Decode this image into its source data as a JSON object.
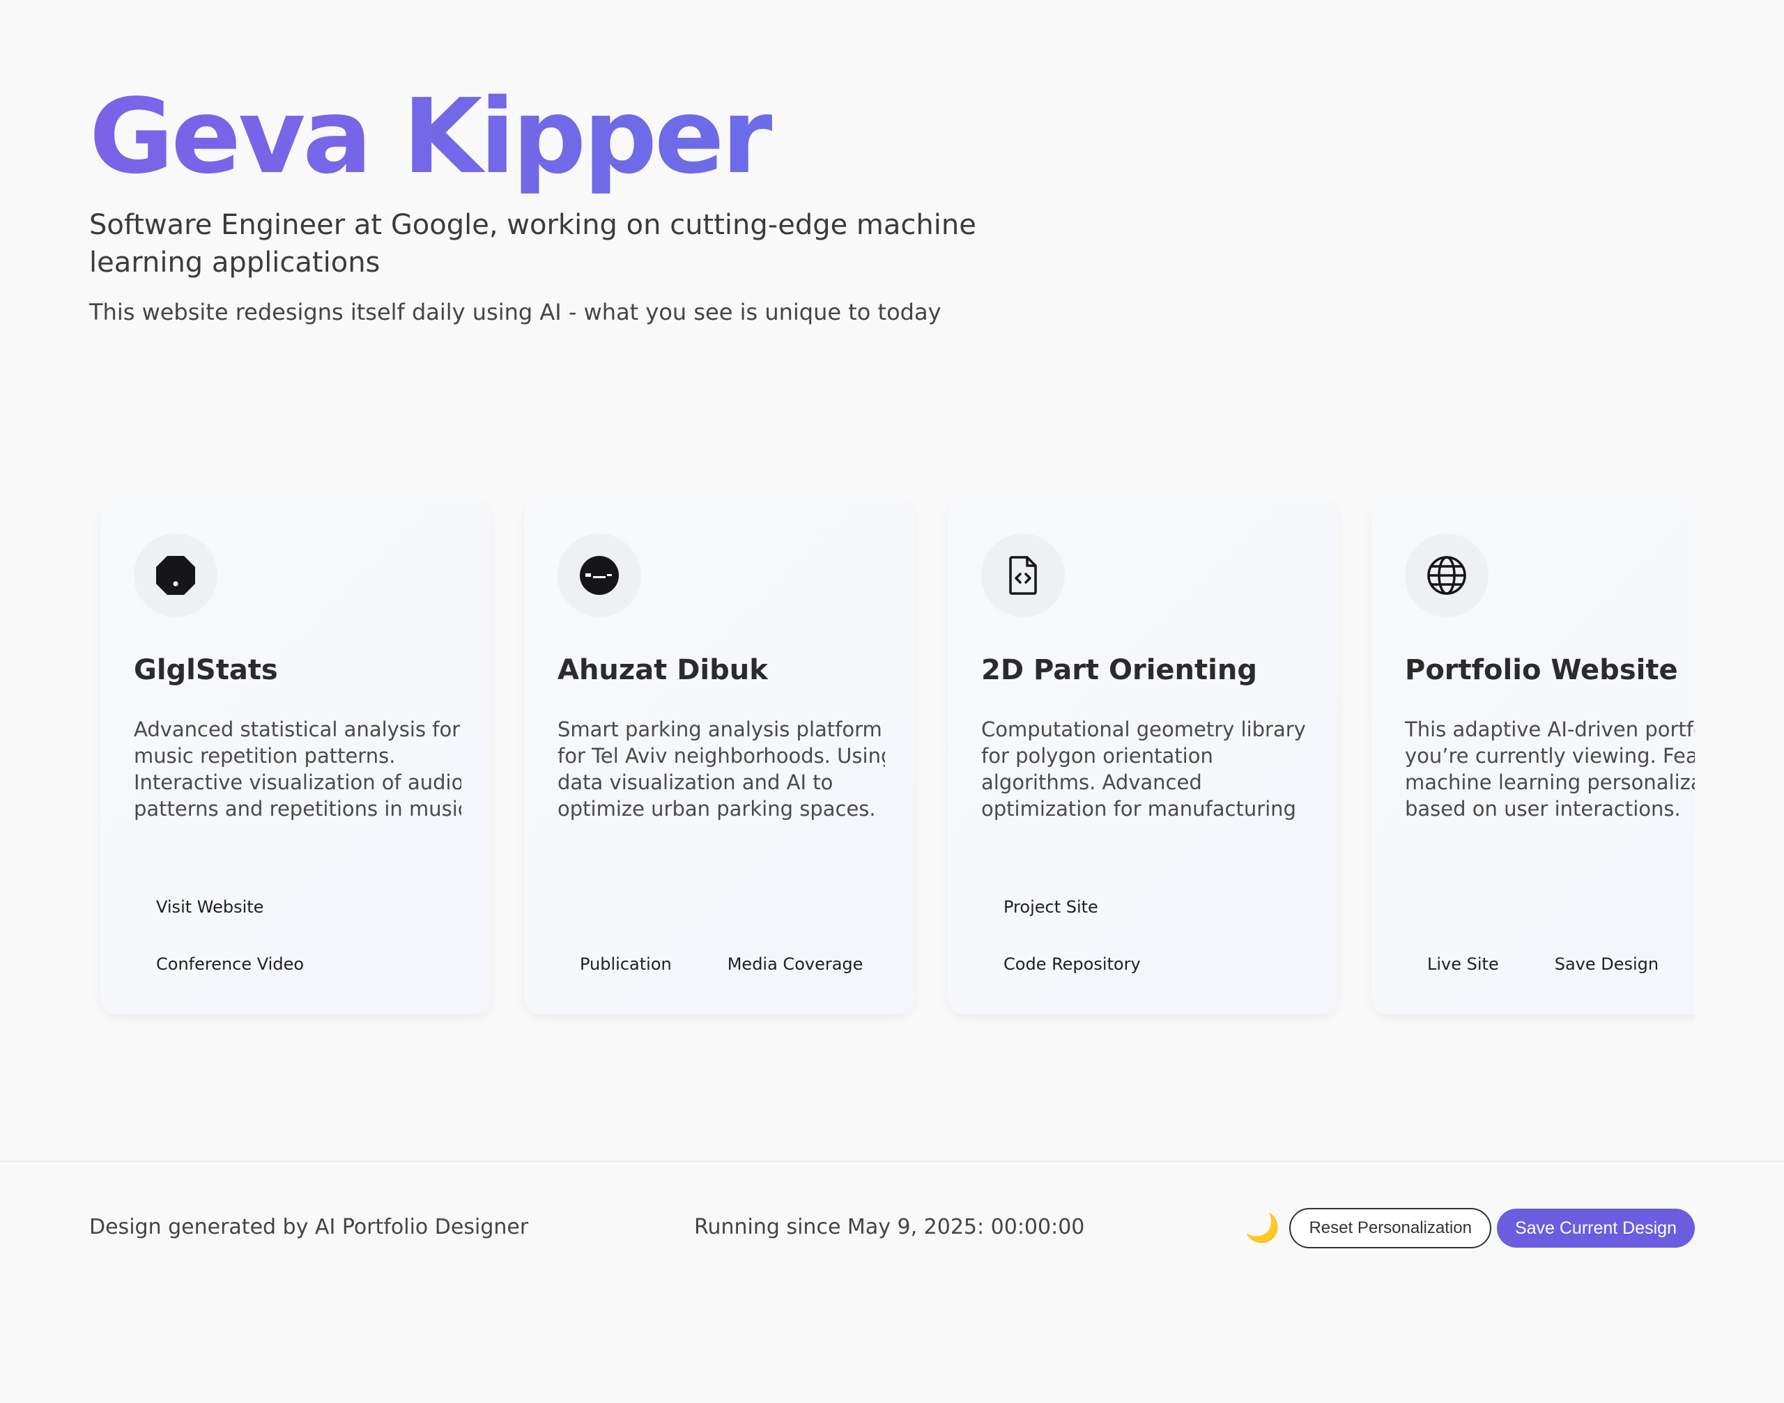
{
  "hero": {
    "title": "Geva Kipper",
    "subtitle": "Software Engineer at Google, working on cutting-edge machine learning applications",
    "note": "This website redesigns itself daily using AI - what you see is unique to today"
  },
  "projects": [
    {
      "icon": "octagon-dot-icon",
      "title": "GlglStats",
      "description_lines": [
        "Advanced statistical analysis for",
        "music repetition patterns.",
        "Interactive visualization of audio",
        "patterns and repetitions in music"
      ],
      "links": [
        [
          "Visit Website"
        ],
        [
          "Conference Video"
        ]
      ]
    },
    {
      "icon": "parking-meter-icon",
      "title": "Ahuzat Dibuk",
      "description_lines": [
        "Smart parking analysis platform",
        "for Tel Aviv neighborhoods. Using",
        "data visualization and AI to",
        "optimize urban parking spaces."
      ],
      "links": [
        [],
        [
          "Publication",
          "Media Coverage"
        ]
      ]
    },
    {
      "icon": "code-file-icon",
      "title": "2D Part Orienting",
      "description_lines": [
        "Computational geometry library",
        "for polygon orientation",
        "algorithms. Advanced",
        "optimization for manufacturing"
      ],
      "links": [
        [
          "Project Site"
        ],
        [
          "Code Repository"
        ]
      ]
    },
    {
      "icon": "globe-icon",
      "title": "Portfolio Website",
      "description_lines": [
        "This adaptive AI-driven portfolio",
        "you’re currently viewing. Features",
        "machine learning personalization",
        "based on user interactions."
      ],
      "links": [
        [],
        [
          "Live Site",
          "Save Design"
        ]
      ]
    }
  ],
  "footer": {
    "credit": "Design generated by AI Portfolio Designer",
    "running": "Running since May 9, 2025: 00:00:00",
    "theme_icon": "🌙",
    "reset_label": "Reset Personalization",
    "save_label": "Save Current Design"
  },
  "colors": {
    "accent": "#6a5de0",
    "title_gradient_start": "#7b63e8",
    "title_gradient_end": "#6470e9",
    "background": "#f9f9f9"
  }
}
